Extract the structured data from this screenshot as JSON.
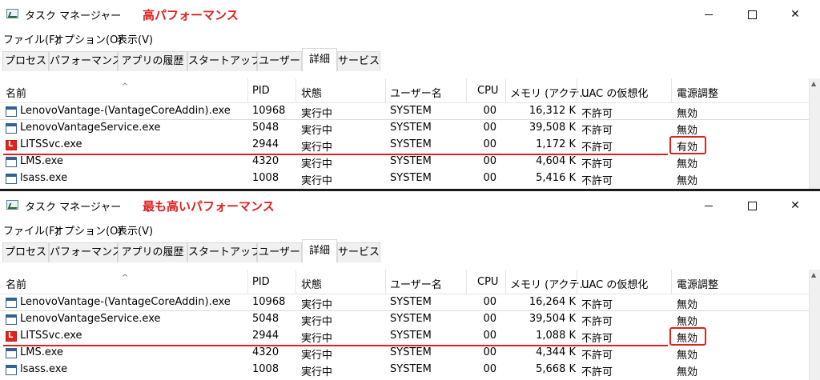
{
  "panels": [
    {
      "title": "タスク マネージャー",
      "annotation": "高パフォーマンス",
      "menu": [
        "ファイル(F)",
        "オプション(O)",
        "表示(V)"
      ],
      "tabs": [
        "プロセス",
        "パフォーマンス",
        "アプリの履歴",
        "スタートアップ",
        "ユーザー",
        "詳細",
        "サービス"
      ],
      "active_tab": "詳細",
      "columns": {
        "name": "名前",
        "pid": "PID",
        "status": "状態",
        "user": "ユーザー名",
        "cpu": "CPU",
        "memory": "メモリ (アクテ...",
        "uac": "UAC の仮想化",
        "power": "電源調整"
      },
      "rows": [
        {
          "name": "LenovoVantage-(VantageCoreAddin).exe",
          "pid": "10968",
          "status": "実行中",
          "user": "SYSTEM",
          "cpu": "00",
          "memory": "16,312 K",
          "uac": "不許可",
          "power": "無効",
          "icon": "process-window-icon"
        },
        {
          "name": "LenovoVantageService.exe",
          "pid": "5048",
          "status": "実行中",
          "user": "SYSTEM",
          "cpu": "00",
          "memory": "39,508 K",
          "uac": "不許可",
          "power": "無効",
          "icon": "process-window-icon"
        },
        {
          "name": "LITSSvc.exe",
          "pid": "2944",
          "status": "実行中",
          "user": "SYSTEM",
          "cpu": "00",
          "memory": "1,172 K",
          "uac": "不許可",
          "power": "有効",
          "icon": "lenovo-icon"
        },
        {
          "name": "LMS.exe",
          "pid": "4320",
          "status": "実行中",
          "user": "SYSTEM",
          "cpu": "00",
          "memory": "4,604 K",
          "uac": "不許可",
          "power": "無効",
          "icon": "process-window-icon"
        },
        {
          "name": "lsass.exe",
          "pid": "1008",
          "status": "実行中",
          "user": "SYSTEM",
          "cpu": "00",
          "memory": "5,416 K",
          "uac": "不許可",
          "power": "無効",
          "icon": "process-window-icon"
        }
      ]
    },
    {
      "title": "タスク マネージャー",
      "annotation": "最も高いパフォーマンス",
      "menu": [
        "ファイル(F)",
        "オプション(O)",
        "表示(V)"
      ],
      "tabs": [
        "プロセス",
        "パフォーマンス",
        "アプリの履歴",
        "スタートアップ",
        "ユーザー",
        "詳細",
        "サービス"
      ],
      "active_tab": "詳細",
      "columns": {
        "name": "名前",
        "pid": "PID",
        "status": "状態",
        "user": "ユーザー名",
        "cpu": "CPU",
        "memory": "メモリ (アクテ...",
        "uac": "UAC の仮想化",
        "power": "電源調整"
      },
      "rows": [
        {
          "name": "LenovoVantage-(VantageCoreAddin).exe",
          "pid": "10968",
          "status": "実行中",
          "user": "SYSTEM",
          "cpu": "00",
          "memory": "16,264 K",
          "uac": "不許可",
          "power": "無効",
          "icon": "process-window-icon"
        },
        {
          "name": "LenovoVantageService.exe",
          "pid": "5048",
          "status": "実行中",
          "user": "SYSTEM",
          "cpu": "00",
          "memory": "39,504 K",
          "uac": "不許可",
          "power": "無効",
          "icon": "process-window-icon"
        },
        {
          "name": "LITSSvc.exe",
          "pid": "2944",
          "status": "実行中",
          "user": "SYSTEM",
          "cpu": "00",
          "memory": "1,088 K",
          "uac": "不許可",
          "power": "無効",
          "icon": "lenovo-icon"
        },
        {
          "name": "LMS.exe",
          "pid": "4320",
          "status": "実行中",
          "user": "SYSTEM",
          "cpu": "00",
          "memory": "4,344 K",
          "uac": "不許可",
          "power": "無効",
          "icon": "process-window-icon"
        },
        {
          "name": "lsass.exe",
          "pid": "1008",
          "status": "実行中",
          "user": "SYSTEM",
          "cpu": "00",
          "memory": "5,668 K",
          "uac": "不許可",
          "power": "無効",
          "icon": "process-window-icon"
        }
      ]
    }
  ],
  "colors": {
    "annotation": "#e02020",
    "highlight": "#e02020"
  }
}
